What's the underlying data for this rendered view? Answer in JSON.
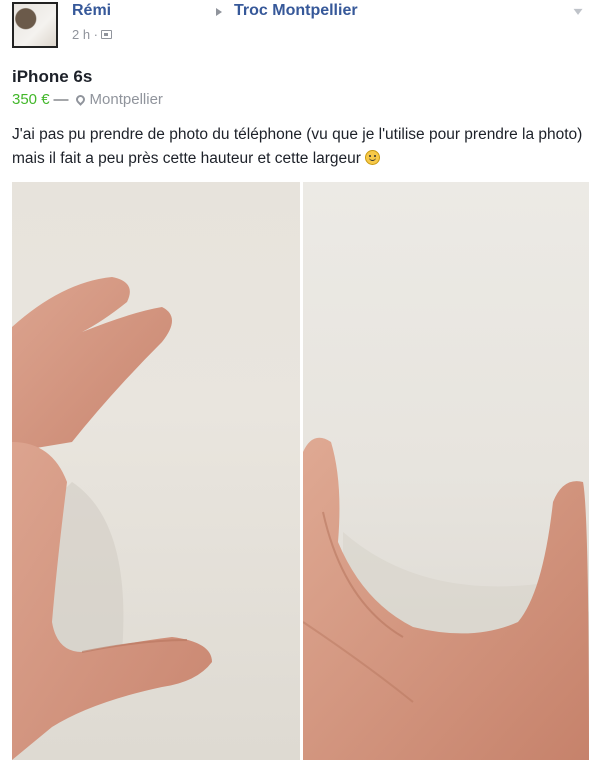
{
  "post": {
    "author": "Rémi",
    "time": "2 h ·",
    "group": "Troc Montpellier",
    "item_title": "iPhone 6s",
    "price": "350 €",
    "separator": "—",
    "location": "Montpellier",
    "text": "J'ai pas pu prendre de photo du téléphone (vu que je l'utilise pour prendre la photo) mais il fait a peu près cette hauteur et cette largeur"
  },
  "icons": {
    "audience": "group-members-icon",
    "location": "map-pin-icon",
    "options": "chevron-down-icon",
    "emoji": "smiley-icon",
    "arrow": "arrow-right-icon"
  },
  "colors": {
    "link": "#365899",
    "price": "#42b72a",
    "meta": "#90949c",
    "text": "#1d2129"
  }
}
